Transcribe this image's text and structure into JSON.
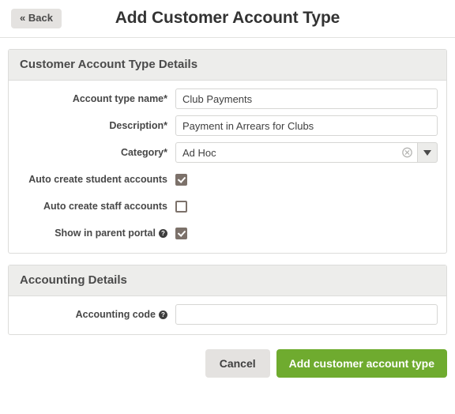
{
  "header": {
    "back_label": "« Back",
    "title": "Add Customer Account Type"
  },
  "details_panel": {
    "title": "Customer Account Type Details",
    "fields": {
      "account_type_name": {
        "label": "Account type name*",
        "value": "Club Payments",
        "placeholder": ""
      },
      "description": {
        "label": "Description*",
        "value": "Payment in Arrears for Clubs",
        "placeholder": ""
      },
      "category": {
        "label": "Category*",
        "value": "Ad Hoc",
        "placeholder": "",
        "clear_icon": "clear-circle-icon",
        "dropdown_icon": "caret-down-icon"
      },
      "auto_create_student_accounts": {
        "label": "Auto create student accounts",
        "checked": true
      },
      "auto_create_staff_accounts": {
        "label": "Auto create staff accounts",
        "checked": false
      },
      "show_in_parent_portal": {
        "label": "Show in parent portal",
        "checked": true,
        "help_icon": "question-mark-icon",
        "help_glyph": "?"
      }
    }
  },
  "accounting_panel": {
    "title": "Accounting Details",
    "fields": {
      "accounting_code": {
        "label": "Accounting code",
        "value": "",
        "placeholder": "",
        "help_icon": "question-mark-icon",
        "help_glyph": "?"
      }
    }
  },
  "actions": {
    "cancel_label": "Cancel",
    "submit_label": "Add customer account type"
  },
  "colors": {
    "primary_button": "#6fab2f",
    "panel_header_bg": "#ededeb",
    "checkbox_fill": "#7c716a",
    "border": "#dcdcda",
    "secondary_button": "#e4e2e0"
  }
}
